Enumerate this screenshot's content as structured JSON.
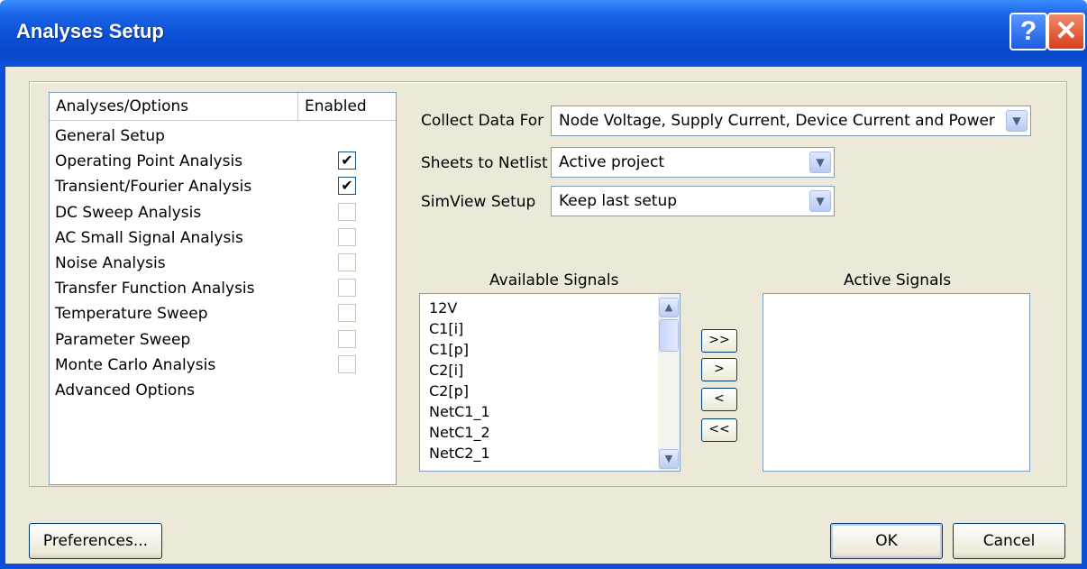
{
  "window": {
    "title": "Analyses Setup",
    "help_glyph": "?",
    "close_glyph": "✕"
  },
  "analyses": {
    "header_col1": "Analyses/Options",
    "header_col2": "Enabled",
    "rows": [
      {
        "label": "General Setup",
        "has_checkbox": false,
        "checked": false
      },
      {
        "label": "Operating Point Analysis",
        "has_checkbox": true,
        "checked": true
      },
      {
        "label": "Transient/Fourier Analysis",
        "has_checkbox": true,
        "checked": true
      },
      {
        "label": "DC Sweep Analysis",
        "has_checkbox": true,
        "checked": false
      },
      {
        "label": "AC Small Signal Analysis",
        "has_checkbox": true,
        "checked": false
      },
      {
        "label": "Noise Analysis",
        "has_checkbox": true,
        "checked": false
      },
      {
        "label": "Transfer Function Analysis",
        "has_checkbox": true,
        "checked": false
      },
      {
        "label": "Temperature Sweep",
        "has_checkbox": true,
        "checked": false
      },
      {
        "label": "Parameter Sweep",
        "has_checkbox": true,
        "checked": false
      },
      {
        "label": "Monte Carlo Analysis",
        "has_checkbox": true,
        "checked": false
      },
      {
        "label": "Advanced Options",
        "has_checkbox": false,
        "checked": false
      }
    ]
  },
  "settings": {
    "collect_label": "Collect Data For",
    "collect_value": "Node Voltage, Supply Current, Device Current and Power",
    "sheets_label": "Sheets to Netlist",
    "sheets_value": "Active project",
    "simview_label": "SimView Setup",
    "simview_value": "Keep last setup"
  },
  "signals": {
    "available_label": "Available Signals",
    "active_label": "Active Signals",
    "available": [
      "12V",
      "C1[i]",
      "C1[p]",
      "C2[i]",
      "C2[p]",
      "NetC1_1",
      "NetC1_2",
      "NetC2_1"
    ],
    "active": []
  },
  "move_buttons": {
    "add_all": ">>",
    "add": ">",
    "remove": "<",
    "remove_all": "<<"
  },
  "buttons": {
    "preferences": "Preferences...",
    "ok": "OK",
    "cancel": "Cancel"
  },
  "icons": {
    "dropdown": "chevron-down-icon",
    "scroll_up": "arrow-up-icon",
    "scroll_down": "arrow-down-icon",
    "check": "checkmark-icon"
  }
}
